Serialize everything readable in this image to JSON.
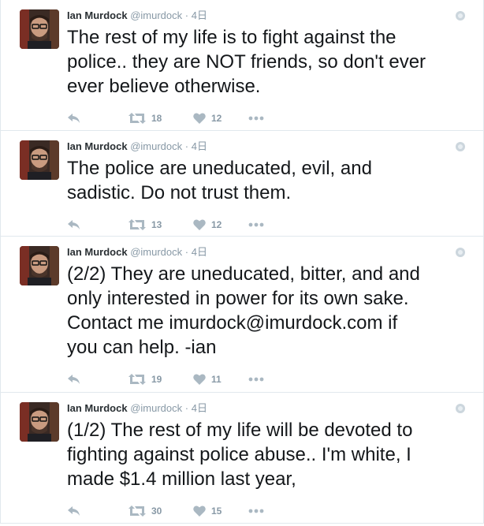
{
  "tweets": [
    {
      "name": "Ian Murdock",
      "handle": "@imurdock",
      "separator": "·",
      "time": "4日",
      "text": "The rest of my life is to fight against the\npolice.. they are NOT friends, so don't ever\never believe otherwise.",
      "retweets": "18",
      "likes": "12"
    },
    {
      "name": "Ian Murdock",
      "handle": "@imurdock",
      "separator": "·",
      "time": "4日",
      "text": "The police are uneducated, evil, and\nsadistic. Do not trust them.",
      "retweets": "13",
      "likes": "12"
    },
    {
      "name": "Ian Murdock",
      "handle": "@imurdock",
      "separator": "·",
      "time": "4日",
      "text": "(2/2) They are uneducated, bitter, and and\nonly interested in power for its own sake.\nContact me imurdock@imurdock.com if\nyou can help. -ian",
      "retweets": "19",
      "likes": "11"
    },
    {
      "name": "Ian Murdock",
      "handle": "@imurdock",
      "separator": "·",
      "time": "4日",
      "text": "(1/2) The rest of my life will be devoted to\nfighting against police abuse.. I'm white, I\nmade $1.4 million last year,",
      "retweets": "30",
      "likes": "15"
    }
  ],
  "icons": {
    "reply": "reply-icon",
    "retweet": "retweet-icon",
    "like": "heart-icon",
    "more": "more-icon",
    "caret": "caret-icon"
  },
  "colors": {
    "text": "#14171a",
    "muted": "#8899a6",
    "border": "#e1e8ed"
  }
}
